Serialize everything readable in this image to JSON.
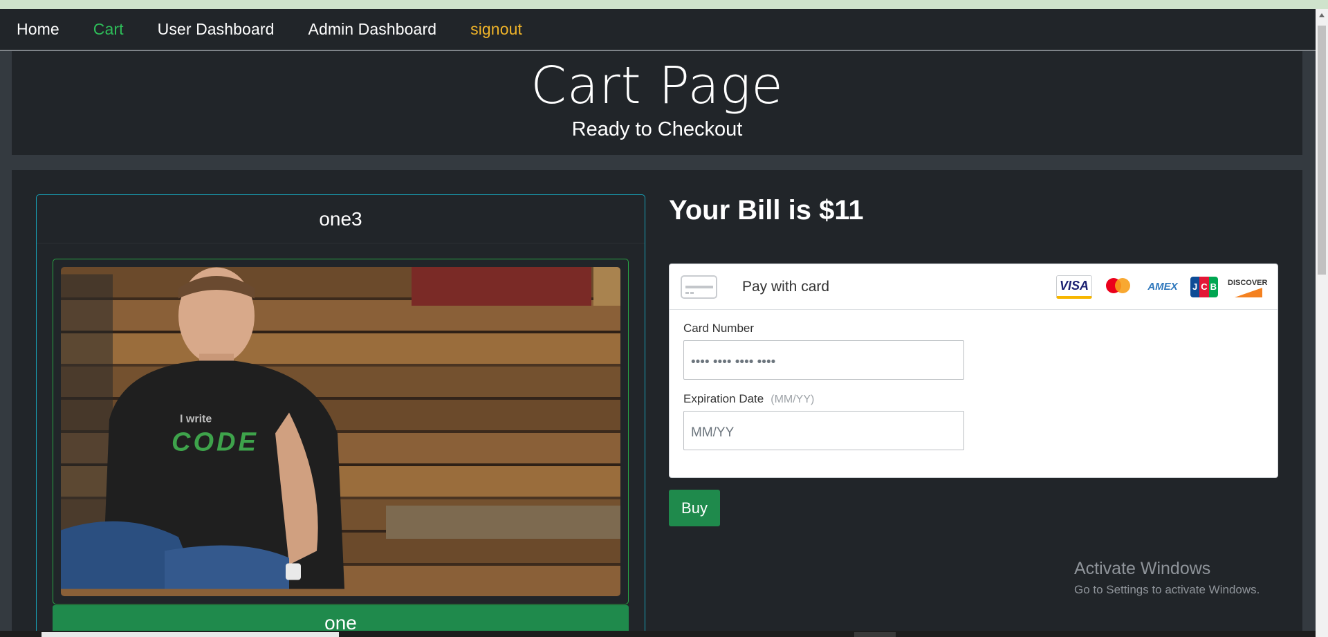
{
  "nav": {
    "links": [
      {
        "label": "Home"
      },
      {
        "label": "Cart"
      },
      {
        "label": "User Dashboard"
      },
      {
        "label": "Admin Dashboard"
      },
      {
        "label": "signout"
      }
    ]
  },
  "header": {
    "title": "Cart Page",
    "subtitle": "Ready to Checkout"
  },
  "product": {
    "name": "one3",
    "category_button": "one",
    "image_text": {
      "line1": "I write",
      "line2": "CODE"
    }
  },
  "bill": {
    "text": "Your Bill is $11"
  },
  "payment": {
    "title": "Pay with card",
    "card_number_label": "Card Number",
    "card_number_placeholder": "•••• •••• •••• ••••",
    "expiration_label": "Expiration Date",
    "expiration_hint": "(MM/YY)",
    "expiration_placeholder": "MM/YY",
    "brands": [
      "VISA",
      "mastercard",
      "AMEX",
      "JCB",
      "DISCOVER"
    ],
    "buy_label": "Buy"
  },
  "watermark": {
    "line1": "Activate Windows",
    "line2": "Go to Settings to activate Windows."
  },
  "colors": {
    "background": "#343a40",
    "panel": "#212529",
    "accent_green": "#1f8a4c",
    "nav_active": "#2ebd59",
    "signout": "#f0b429",
    "card_border": "#17a2b8"
  }
}
